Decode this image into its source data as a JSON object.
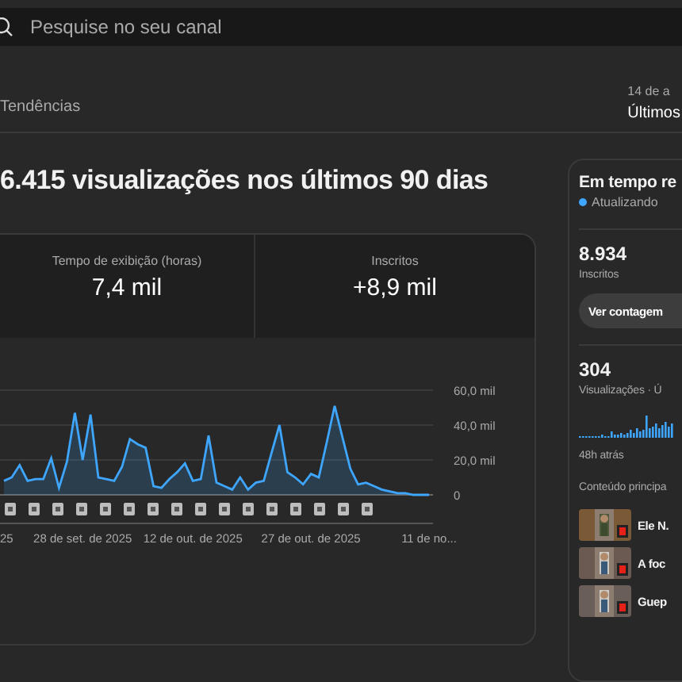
{
  "search": {
    "placeholder": "Pesquise no seu canal"
  },
  "tabs": [
    {
      "label": "Tendências",
      "selected": false
    }
  ],
  "date_range": {
    "range": "14 de a",
    "label": "Últimos"
  },
  "headline": "6.415 visualizações nos últimos 90 dias",
  "metrics": [
    {
      "label": "Tempo de exibição (horas)",
      "value": "7,4 mil"
    },
    {
      "label": "Inscritos",
      "value": "+8,9 mil"
    }
  ],
  "chart_data": {
    "type": "area",
    "categories": [
      null,
      null,
      null,
      null,
      null,
      null,
      null,
      null,
      null,
      null,
      "28 de set. de 2025",
      null,
      null,
      null,
      null,
      null,
      null,
      null,
      null,
      null,
      null,
      null,
      null,
      null,
      "12 de out. de 2025",
      null,
      null,
      null,
      null,
      null,
      null,
      null,
      null,
      null,
      null,
      null,
      null,
      null,
      null,
      "27 de out. de 2025",
      null,
      null,
      null,
      null,
      null,
      null,
      null,
      null,
      null,
      null,
      null,
      null,
      null,
      null,
      "11 de no..."
    ],
    "series": [
      {
        "color": "#3ea6ff",
        "values": [
          8,
          10,
          17,
          8,
          9,
          9,
          21,
          4,
          19,
          47,
          20,
          46,
          10,
          9,
          8,
          16,
          32,
          29,
          27,
          5,
          4,
          9,
          13,
          18,
          8,
          9,
          34,
          7,
          5,
          3,
          10,
          3,
          7,
          8,
          24,
          40,
          13,
          10,
          6,
          12,
          10,
          30,
          51,
          33,
          15,
          6,
          7,
          5,
          3,
          2,
          1,
          1,
          0,
          0,
          0
        ]
      }
    ],
    "ylim": [
      0,
      60
    ],
    "yticks": [
      {
        "value": 0,
        "label": "0"
      },
      {
        "value": 20,
        "label": "20,0 mil"
      },
      {
        "value": 40,
        "label": "40,0 mil"
      },
      {
        "value": 60,
        "label": "60,0 mil"
      }
    ]
  },
  "x_axis_cut_label": "25",
  "realtime": {
    "title": "Em tempo re",
    "status": "Atualizando",
    "subscribers": {
      "value": "8.934",
      "label": "Inscritos"
    },
    "button": "Ver contagem",
    "views": {
      "value": "304",
      "label": "Visualizações · Ú"
    },
    "timeline_start": "48h atrás",
    "top_content": {
      "title": "Conteúdo principa",
      "items": [
        {
          "title": "Ele N."
        },
        {
          "title": "A foc"
        },
        {
          "title": "Guep"
        }
      ]
    }
  }
}
